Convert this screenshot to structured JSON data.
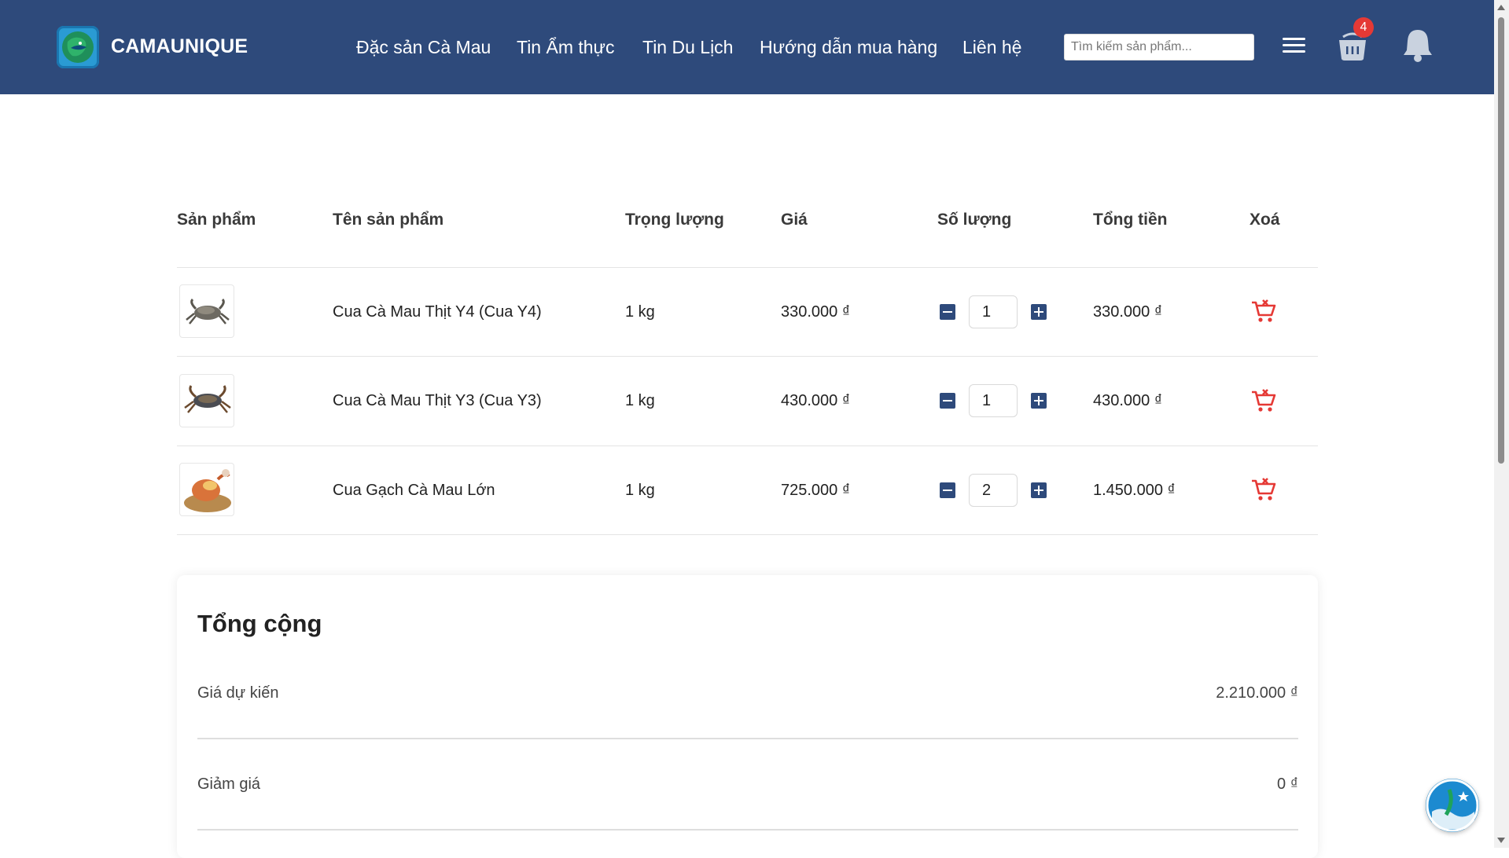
{
  "header": {
    "brand": "CAMAUNIQUE",
    "nav": [
      {
        "label": "Đặc sản Cà Mau"
      },
      {
        "label": "Tin Ẩm thực"
      },
      {
        "label": "Tin Du Lịch"
      },
      {
        "label": "Hướng dẫn mua hàng"
      },
      {
        "label": "Liên hệ"
      }
    ],
    "search_placeholder": "Tìm kiếm sản phẩm...",
    "cart_count": "4",
    "icons": [
      "logo-icon",
      "menu-icon",
      "cart-icon",
      "bell-icon"
    ],
    "colors": {
      "header_bg": "#2e4a7b",
      "badge": "#e53935",
      "delete_icon": "#e53935"
    }
  },
  "cart": {
    "columns": [
      "Sản phẩm",
      "Tên sản phẩm",
      "Trọng lượng",
      "Giá",
      "Số lượng",
      "Tổng tiền",
      "Xoá"
    ],
    "items": [
      {
        "name": "Cua Cà Mau Thịt Y4 (Cua Y4)",
        "weight": "1 kg",
        "price": "330.000 ₫",
        "qty": "1",
        "total": "330.000 ₫"
      },
      {
        "name": "Cua Cà Mau Thịt Y3 (Cua Y3)",
        "weight": "1 kg",
        "price": "430.000 ₫",
        "qty": "1",
        "total": "430.000 ₫"
      },
      {
        "name": "Cua Gạch Cà Mau Lớn",
        "weight": "1 kg",
        "price": "725.000 ₫",
        "qty": "2",
        "total": "1.450.000 ₫"
      }
    ]
  },
  "summary": {
    "title": "Tổng cộng",
    "rows": [
      {
        "label": "Giá dự kiến",
        "value": "2.210.000 ₫"
      },
      {
        "label": "Giảm giá",
        "value": "0 ₫"
      }
    ]
  }
}
